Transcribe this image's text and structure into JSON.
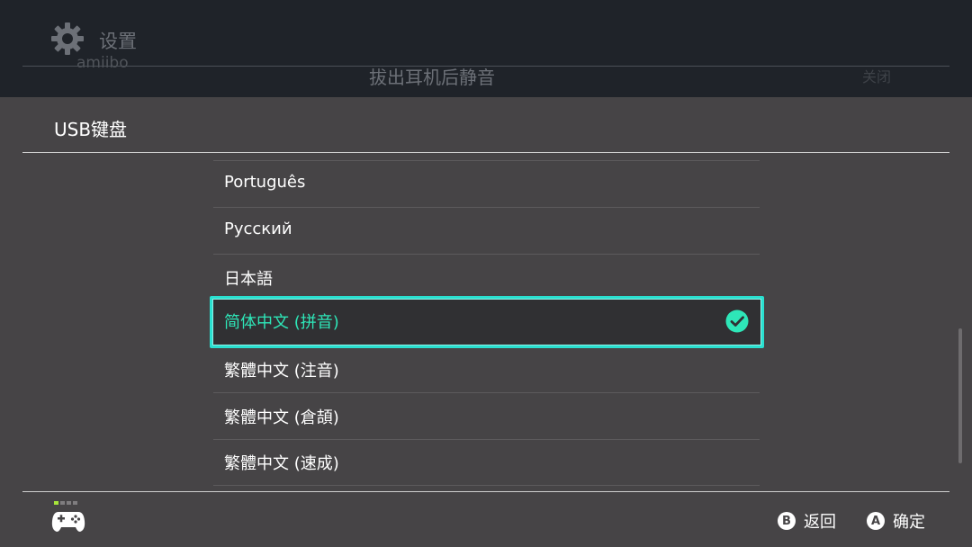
{
  "background": {
    "title": "设置",
    "amiibo_label": "amiibo",
    "mute_label": "拔出耳机后静音",
    "mute_value": "关闭"
  },
  "panel": {
    "title": "USB键盘",
    "items": [
      {
        "label": "Português",
        "selected": false
      },
      {
        "label": "Русский",
        "selected": false
      },
      {
        "label": "日本語",
        "selected": false
      },
      {
        "label": "简体中文 (拼音)",
        "selected": true
      },
      {
        "label": "繁體中文 (注音)",
        "selected": false
      },
      {
        "label": "繁體中文 (倉頡)",
        "selected": false
      },
      {
        "label": "繁體中文 (速成)",
        "selected": false
      }
    ]
  },
  "footer": {
    "back": {
      "glyph": "B",
      "label": "返回"
    },
    "confirm": {
      "glyph": "A",
      "label": "确定"
    }
  },
  "icons": {
    "settings": "gear-icon",
    "selected": "checkmark-icon",
    "controller": "controller-icon",
    "b_button": "b-button-icon",
    "a_button": "a-button-icon"
  },
  "colors": {
    "accent": "#2ae0d0",
    "selected_text": "#2ee6b8",
    "panel_bg": "#464446",
    "header_bg": "#1f2329",
    "controller_dot": "#a8e63a"
  }
}
